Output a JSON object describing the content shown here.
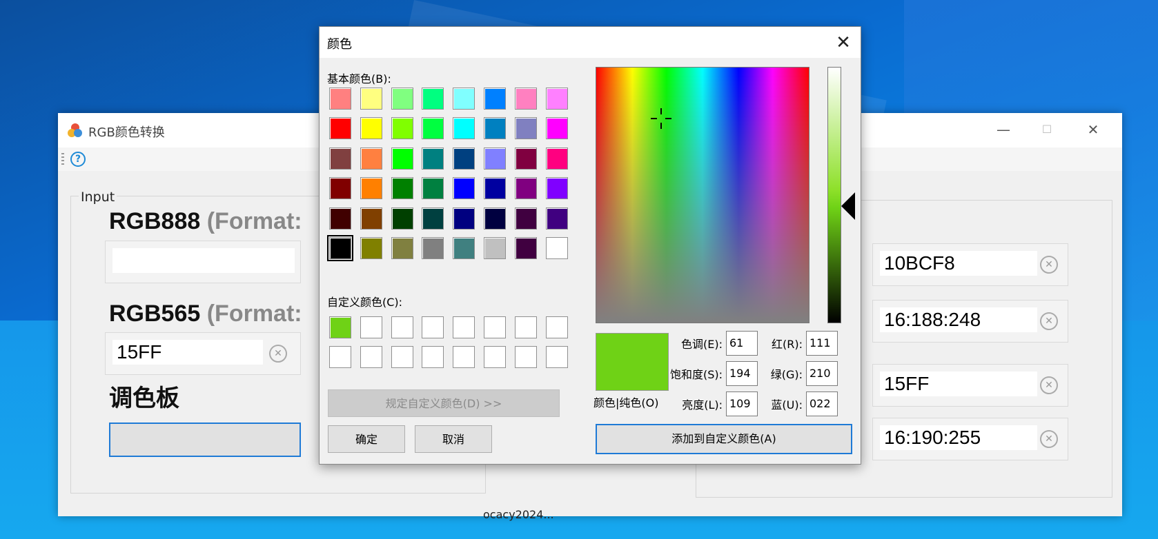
{
  "main_window": {
    "title": "RGB颜色转换",
    "controls": {
      "minimize": "—",
      "maximize": "☐",
      "close": "✕"
    },
    "input_group": {
      "label": "Input",
      "rgb888_label": "RGB888",
      "rgb888_format": "(Format:",
      "rgb888_value": "",
      "rgb565_label": "RGB565",
      "rgb565_format": "(Format:",
      "rgb565_value": "15FF",
      "palette_label": "调色板"
    },
    "output_group": {
      "fields": [
        {
          "value": "10BCF8"
        },
        {
          "value": "16:188:248"
        },
        {
          "value": "15FF"
        },
        {
          "value": "16:190:255"
        }
      ]
    },
    "footer_text": "ocacy2024..."
  },
  "color_dialog": {
    "title": "颜色",
    "basic_colors_label": "基本颜色(B):",
    "basic_colors": [
      "#ff8080",
      "#ffff80",
      "#80ff80",
      "#00ff80",
      "#80ffff",
      "#0080ff",
      "#ff80c0",
      "#ff80ff",
      "#ff0000",
      "#ffff00",
      "#80ff00",
      "#00ff40",
      "#00ffff",
      "#0080c0",
      "#8080c0",
      "#ff00ff",
      "#804040",
      "#ff8040",
      "#00ff00",
      "#008080",
      "#004080",
      "#8080ff",
      "#800040",
      "#ff0080",
      "#800000",
      "#ff8000",
      "#008000",
      "#008040",
      "#0000ff",
      "#0000a0",
      "#800080",
      "#8000ff",
      "#400000",
      "#804000",
      "#004000",
      "#004040",
      "#000080",
      "#000040",
      "#400040",
      "#400080",
      "#000000",
      "#808000",
      "#808040",
      "#808080",
      "#408080",
      "#c0c0c0",
      "#400040",
      "#ffffff"
    ],
    "custom_colors_label": "自定义颜色(C):",
    "custom_colors": [
      "#6fd216",
      "#ffffff",
      "#ffffff",
      "#ffffff",
      "#ffffff",
      "#ffffff",
      "#ffffff",
      "#ffffff",
      "#ffffff",
      "#ffffff",
      "#ffffff",
      "#ffffff",
      "#ffffff",
      "#ffffff",
      "#ffffff",
      "#ffffff"
    ],
    "define_custom_button": "规定自定义颜色(D) >>",
    "ok_button": "确定",
    "cancel_button": "取消",
    "preview_label": "颜色|纯色(O)",
    "preview_color": "#6fd216",
    "hue_label": "色调(E):",
    "hue_value": "61",
    "saturation_label": "饱和度(S):",
    "saturation_value": "194",
    "luminance_label": "亮度(L):",
    "luminance_value": "109",
    "red_label": "红(R):",
    "red_value": "111",
    "green_label": "绿(G):",
    "green_value": "210",
    "blue_label": "蓝(U):",
    "blue_value": "022",
    "add_custom_button": "添加到自定义颜色(A)"
  }
}
